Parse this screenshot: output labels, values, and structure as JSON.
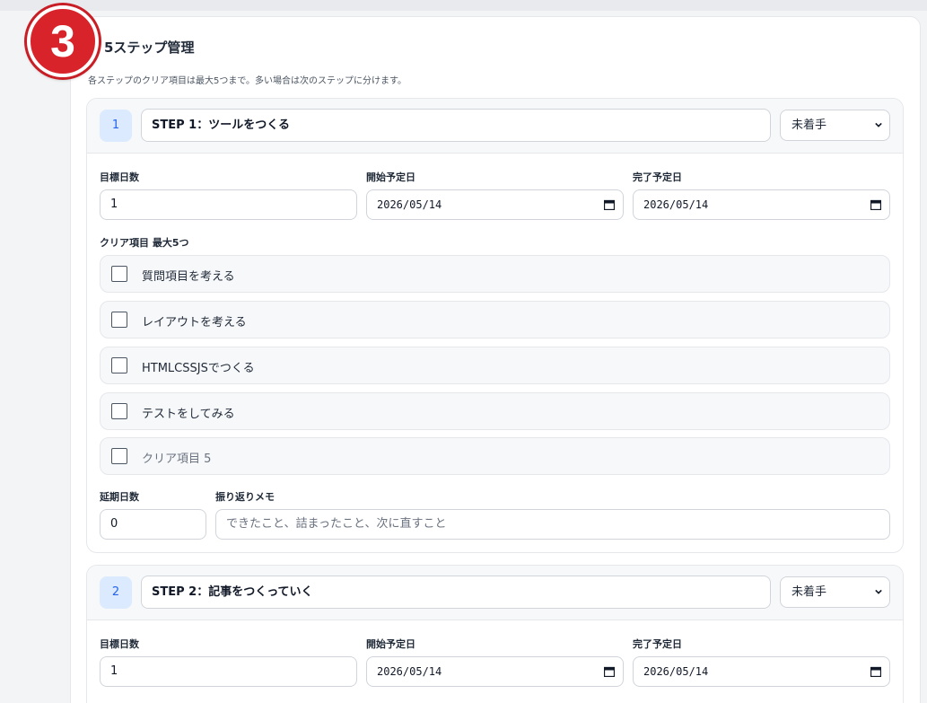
{
  "badge": "3",
  "header": {
    "title": "5ステップ管理",
    "subtitle": "各ステップのクリア項目は最大5つまで。多い場合は次のステップに分けます。"
  },
  "labels": {
    "target_days": "目標日数",
    "start_date": "開始予定日",
    "end_date": "完了予定日",
    "checklist": "クリア項目 最大5つ",
    "delay_days": "延期日数",
    "memo": "振り返りメモ"
  },
  "steps": [
    {
      "number": "1",
      "title": "STEP 1：ツールをつくる",
      "status": "未着手",
      "target_days": "1",
      "start_date": "2026/05/14",
      "end_date": "2026/05/14",
      "items": [
        {
          "text": "質問項目を考える"
        },
        {
          "text": "レイアウトを考える"
        },
        {
          "text": "HTMLCSSJSでつくる"
        },
        {
          "text": "テストをしてみる"
        },
        {
          "placeholder": "クリア項目 5"
        }
      ],
      "delay_days": "0",
      "memo_placeholder": "できたこと、詰まったこと、次に直すこと"
    },
    {
      "number": "2",
      "title": "STEP 2：記事をつくっていく",
      "status": "未着手",
      "target_days": "1",
      "start_date": "2026/05/14",
      "end_date": "2026/05/14"
    }
  ]
}
